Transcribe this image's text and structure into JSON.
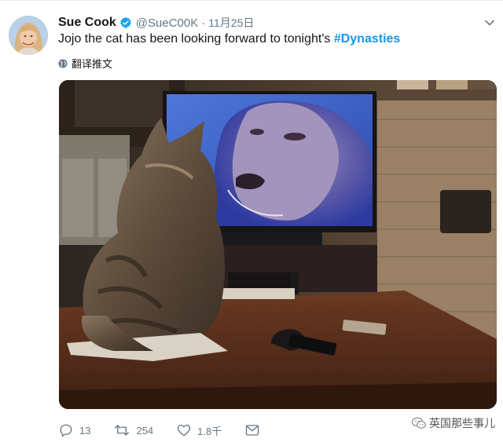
{
  "tweet": {
    "display_name": "Sue Cook",
    "handle": "@SueC00K",
    "separator": "·",
    "date": "11月25日",
    "text_prefix": "Jojo the cat has been looking forward to tonight's ",
    "hashtag": "#Dynasties",
    "translate_label": "翻译推文"
  },
  "actions": {
    "replies": "13",
    "retweets": "254",
    "likes": "1.8千"
  },
  "watermark": {
    "text": "英国那些事儿"
  },
  "colors": {
    "accent": "#1b95e0",
    "secondary_text": "#657786",
    "primary_text": "#14171a"
  },
  "icons": [
    "verified-badge-icon",
    "chevron-down-icon",
    "globe-icon",
    "reply-icon",
    "retweet-icon",
    "like-icon",
    "mail-icon",
    "wechat-icon"
  ]
}
